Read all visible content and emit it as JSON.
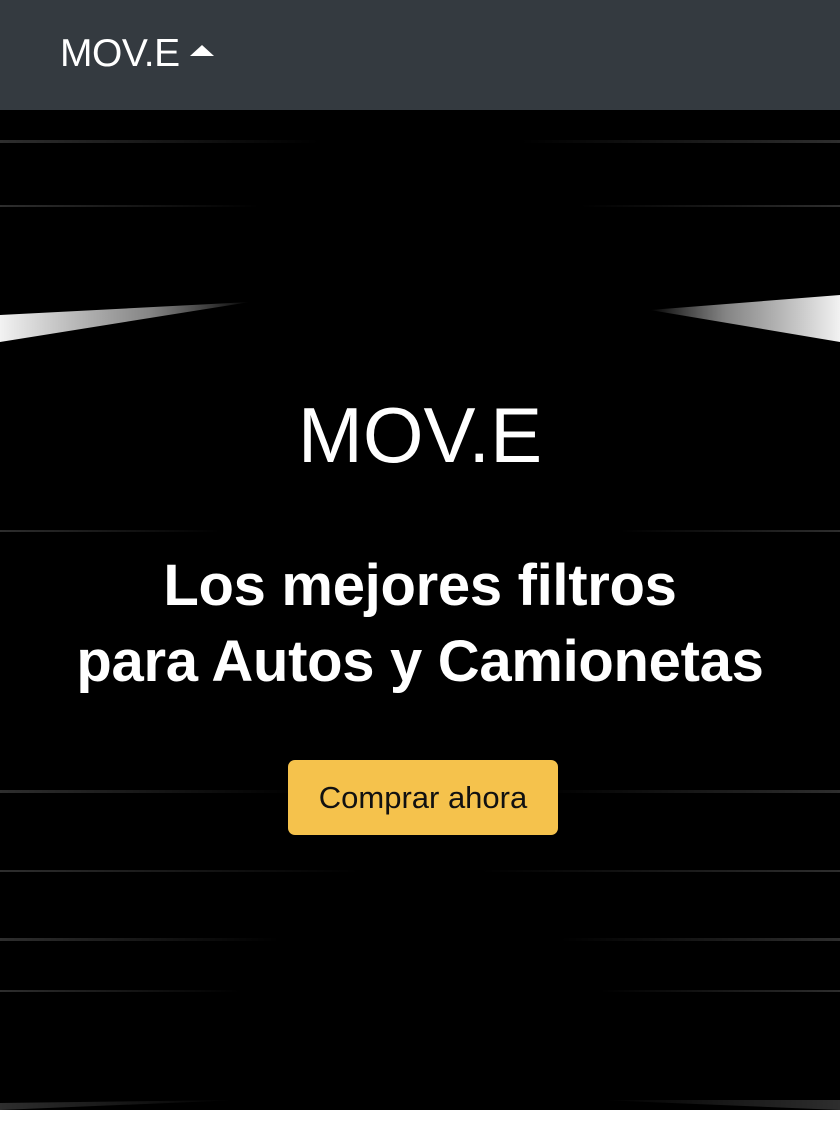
{
  "navbar": {
    "brand": "MOV.E",
    "caret_icon": "caret-up-icon",
    "background": "#343a40"
  },
  "hero": {
    "title": "MOV.E",
    "subtitle_line1": "Los mejores filtros",
    "subtitle_line2": "para Autos y Camionetas",
    "cta_label": "Comprar ahora",
    "cta_color": "#f5c24c",
    "background": "#000000"
  }
}
